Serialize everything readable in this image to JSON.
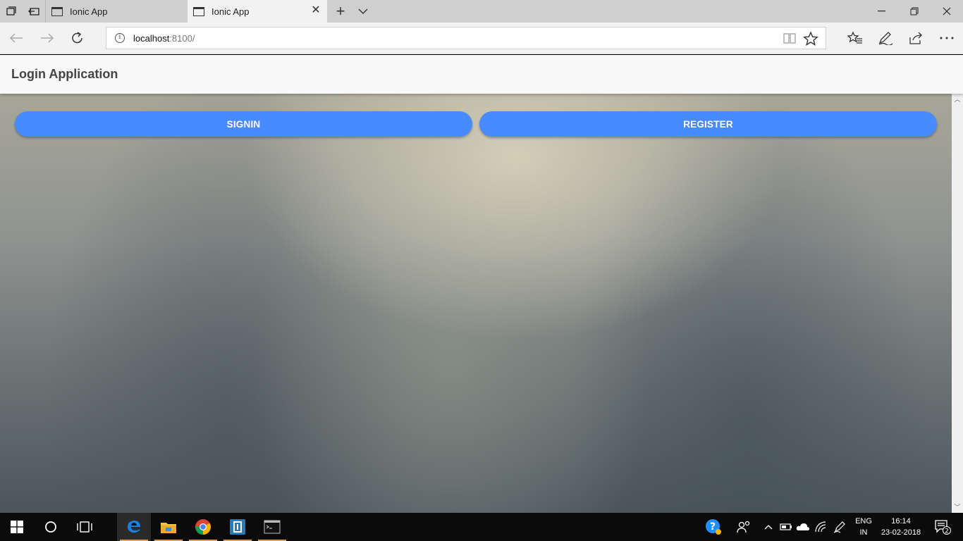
{
  "browser": {
    "tabs": [
      {
        "title": "Ionic App",
        "active": false
      },
      {
        "title": "Ionic App",
        "active": true
      }
    ],
    "address": {
      "host": "localhost",
      "port_path": ":8100/"
    }
  },
  "app": {
    "title": "Login Application",
    "buttons": {
      "signin": "SIGNIN",
      "register": "REGISTER"
    },
    "accent_color": "#488aff"
  },
  "taskbar": {
    "apps": [
      "edge-icon",
      "file-explorer-icon",
      "chrome-icon",
      "app-icon",
      "terminal-icon"
    ],
    "language": {
      "code": "ENG",
      "region": "IN"
    },
    "clock": {
      "time": "16:14",
      "date": "23-02-2018"
    },
    "notifications": "2"
  }
}
